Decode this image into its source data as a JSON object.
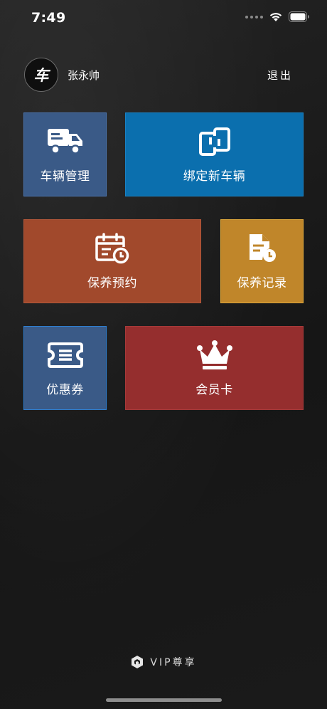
{
  "status_bar": {
    "time": "7:49",
    "icons": [
      "signal-dots-icon",
      "wifi-icon",
      "battery-icon"
    ]
  },
  "header": {
    "avatar_text": "车",
    "user_name": "张永帅",
    "logout_label": "退出"
  },
  "tiles": [
    {
      "label": "车辆管理",
      "icon": "truck-icon",
      "color": "#3a5a87"
    },
    {
      "label": "绑定新车辆",
      "icon": "link-icon",
      "color": "#0b6fae"
    },
    {
      "label": "保养预约",
      "icon": "calendar-clock-icon",
      "color": "#a1492c"
    },
    {
      "label": "保养记录",
      "icon": "document-clock-icon",
      "color": "#c0862a"
    },
    {
      "label": "优惠券",
      "icon": "ticket-icon",
      "color": "#3a5a87"
    },
    {
      "label": "会员卡",
      "icon": "crown-icon",
      "color": "#952e2e"
    }
  ],
  "footer": {
    "text": "VIP尊享",
    "icon": "vip-logo-icon"
  }
}
